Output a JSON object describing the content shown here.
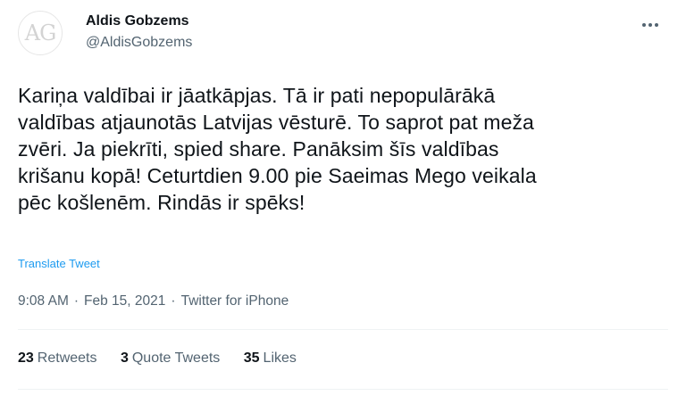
{
  "author": {
    "avatar_initials": "AG",
    "display_name": "Aldis Gobzems",
    "handle": "@AldisGobzems"
  },
  "tweet": {
    "lines": [
      "Kariņa valdībai ir jāatkāpjas. Tā ir pati nepopulārākā",
      "valdības atjaunotās Latvijas vēsturē. To saprot pat meža",
      "zvēri. Ja piekrīti, spied share. Panāksim šīs valdības",
      "krišanu kopā! Ceturtdien 9.00 pie Saeimas Mego veikala",
      "pēc košlenēm. Rindās ir spēks!"
    ],
    "translate_label": "Translate Tweet",
    "time": "9:08 AM",
    "date": "Feb 15, 2021",
    "source": "Twitter for iPhone",
    "separator": "·"
  },
  "stats": {
    "retweets_count": "23",
    "retweets_label": "Retweets",
    "quotes_count": "3",
    "quotes_label": "Quote Tweets",
    "likes_count": "35",
    "likes_label": "Likes"
  },
  "icons": {
    "more": "more-horizontal-icon"
  },
  "colors": {
    "link": "#1d9bf0",
    "secondary_text": "#536471",
    "primary_text": "#0f1419"
  }
}
